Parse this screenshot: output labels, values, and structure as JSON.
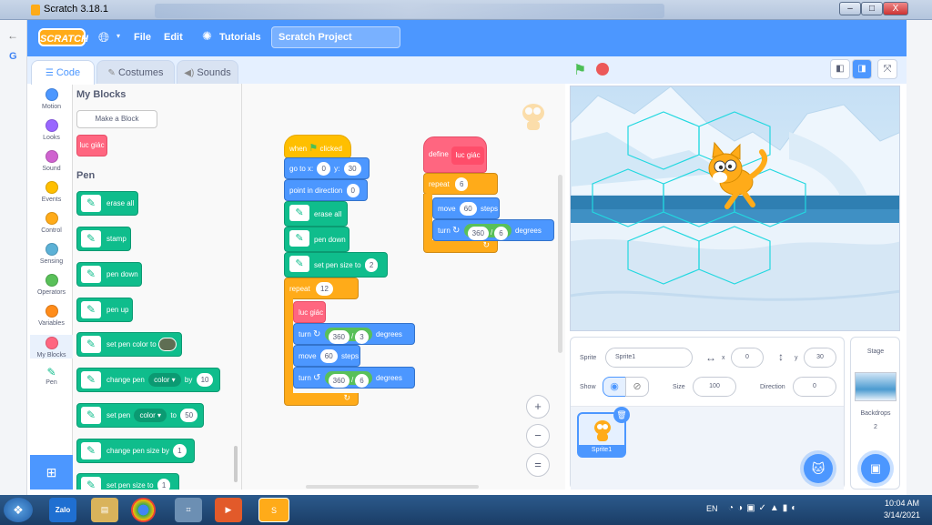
{
  "window": {
    "title": "Scratch 3.18.1",
    "controls": [
      "–",
      "□",
      "X"
    ]
  },
  "menubar": {
    "logo": "SCRATCH",
    "file": "File",
    "edit": "Edit",
    "tutorials": "Tutorials",
    "project_title": "Scratch Project"
  },
  "tabs": {
    "code": "Code",
    "costumes": "Costumes",
    "sounds": "Sounds"
  },
  "categories": [
    {
      "label": "Motion",
      "color": "#4c97ff"
    },
    {
      "label": "Looks",
      "color": "#9966ff"
    },
    {
      "label": "Sound",
      "color": "#cf63cf"
    },
    {
      "label": "Events",
      "color": "#ffbf00"
    },
    {
      "label": "Control",
      "color": "#ffab19"
    },
    {
      "label": "Sensing",
      "color": "#5cb1d6"
    },
    {
      "label": "Operators",
      "color": "#59c059"
    },
    {
      "label": "Variables",
      "color": "#ff8c1a"
    },
    {
      "label": "My Blocks",
      "color": "#ff6680"
    },
    {
      "label": "Pen",
      "color": "#0fbd8c"
    }
  ],
  "palette": {
    "myblocks_heading": "My Blocks",
    "make_block": "Make a Block",
    "custom_block": "luc giác",
    "pen_heading": "Pen",
    "erase_all": "erase all",
    "stamp": "stamp",
    "pen_down": "pen down",
    "pen_up": "pen up",
    "set_pen_color_to": "set pen color to",
    "change_pen": "change pen",
    "color_dd": "color",
    "by": "by",
    "change_by_val": "10",
    "set_pen": "set pen",
    "to": "to",
    "set_to_val": "50",
    "change_pen_size_by": "change pen size by",
    "change_size_val": "1",
    "set_pen_size_to": "set pen size to",
    "set_size_val": "1"
  },
  "script1": {
    "when_flag": "when",
    "clicked": "clicked",
    "goto_x": "go to x:",
    "x_val": "0",
    "y_lbl": "y:",
    "y_val": "30",
    "point_dir": "point in direction",
    "dir_val": "0",
    "erase_all": "erase all",
    "pen_down": "pen down",
    "set_pen_size": "set pen size to",
    "size_val": "2",
    "repeat": "repeat",
    "repeat_val": "12",
    "call": "luc giác",
    "turn": "turn",
    "turn1_a": "360",
    "slash": "/",
    "turn1_b": "3",
    "degrees": "degrees",
    "move": "move",
    "move_val": "60",
    "steps": "steps",
    "turn2_a": "360",
    "turn2_b": "6"
  },
  "script2": {
    "define": "define",
    "name": "luc giác",
    "repeat": "repeat",
    "repeat_val": "6",
    "move": "move",
    "move_val": "60",
    "steps": "steps",
    "turn": "turn",
    "turn_a": "360",
    "slash": "/",
    "turn_b": "6",
    "degrees": "degrees"
  },
  "zoom": {
    "in": "+",
    "out": "−",
    "reset": "="
  },
  "sprite_info": {
    "sprite_label": "Sprite",
    "sprite_name": "Sprite1",
    "x_label": "x",
    "x_val": "0",
    "y_label": "y",
    "y_val": "30",
    "show_label": "Show",
    "size_label": "Size",
    "size_val": "100",
    "direction_label": "Direction",
    "direction_val": "0",
    "thumb_label": "Sprite1"
  },
  "stage_pane": {
    "title": "Stage",
    "backdrops_label": "Backdrops",
    "backdrops_count": "2"
  },
  "taskbar": {
    "zalo": "Zalo",
    "lang": "EN",
    "time": "10:04 AM",
    "date": "3/14/2021"
  }
}
